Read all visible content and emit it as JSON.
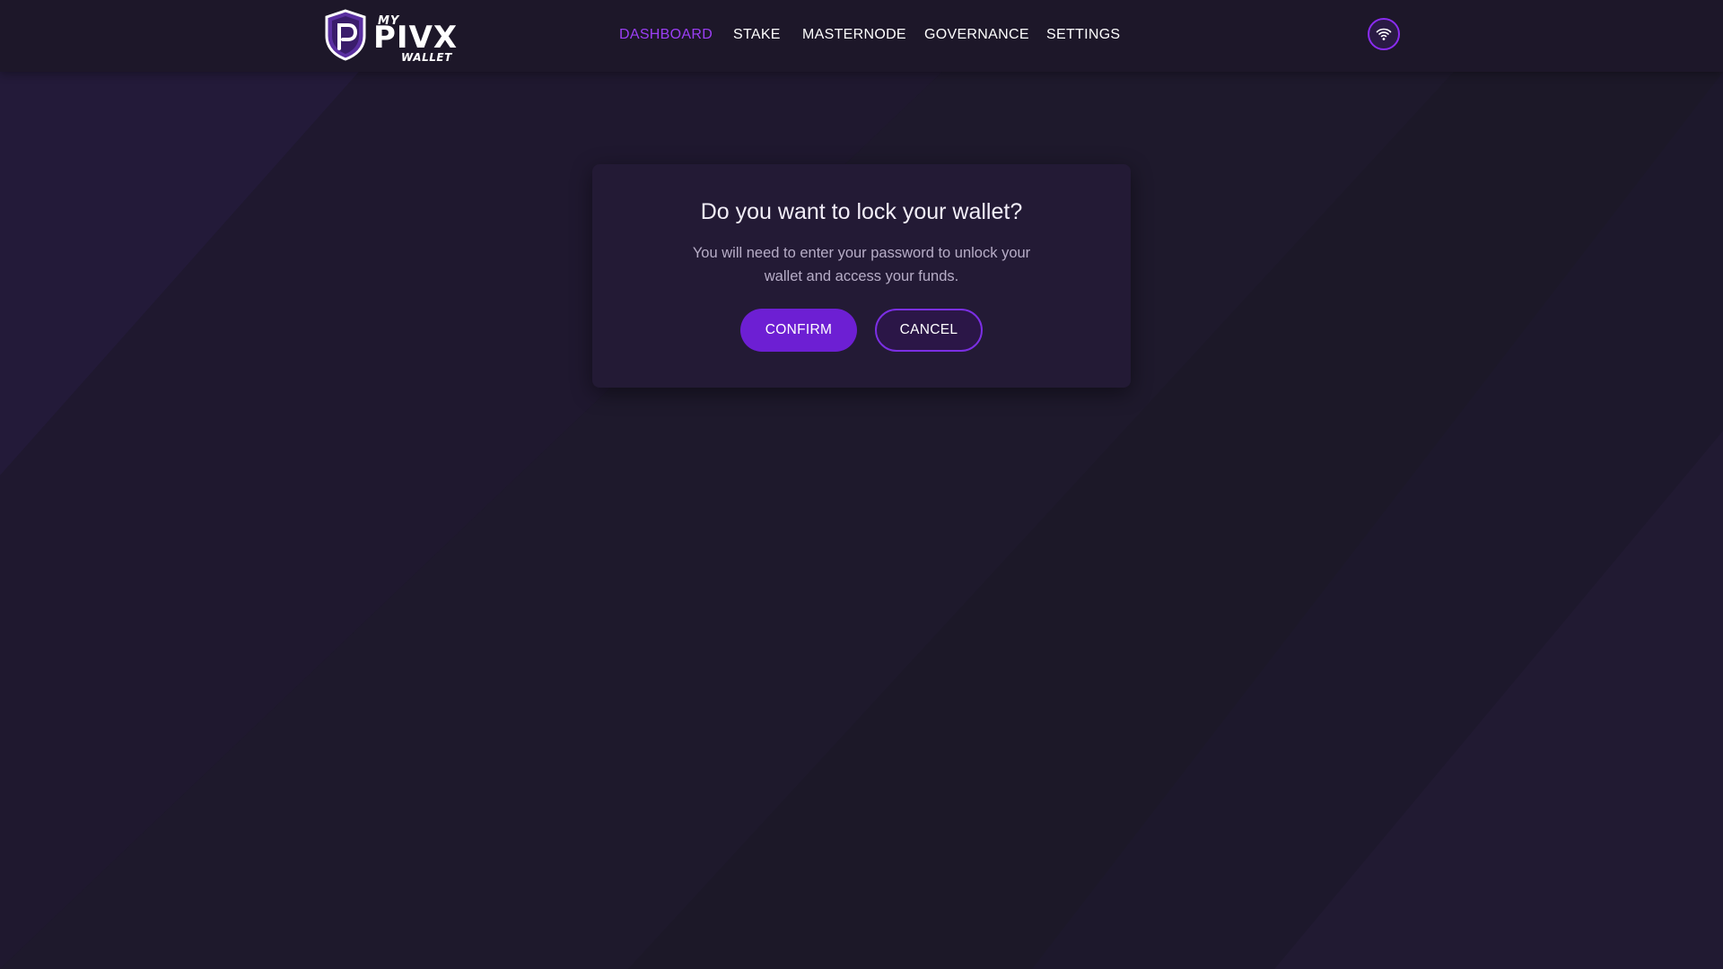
{
  "brand": {
    "logo_my": "MY",
    "logo_name": "PIVX",
    "logo_wallet": "WALLET"
  },
  "nav": {
    "items": [
      {
        "label": "DASHBOARD",
        "active": true
      },
      {
        "label": "STAKE",
        "active": false
      },
      {
        "label": "MASTERNODE",
        "active": false
      },
      {
        "label": "GOVERNANCE",
        "active": false
      },
      {
        "label": "SETTINGS",
        "active": false
      }
    ],
    "network_icon": "wifi-icon"
  },
  "dialog": {
    "title": "Do you want to lock your wallet?",
    "message": "You will need to enter your password to unlock your wallet and access your funds.",
    "confirm_label": "CONFIRM",
    "cancel_label": "CANCEL"
  },
  "colors": {
    "background": "#1c1828",
    "accent": "#9c3ff6",
    "confirm_button": "#6d1fd3",
    "dialog_bg": "#231a35"
  }
}
